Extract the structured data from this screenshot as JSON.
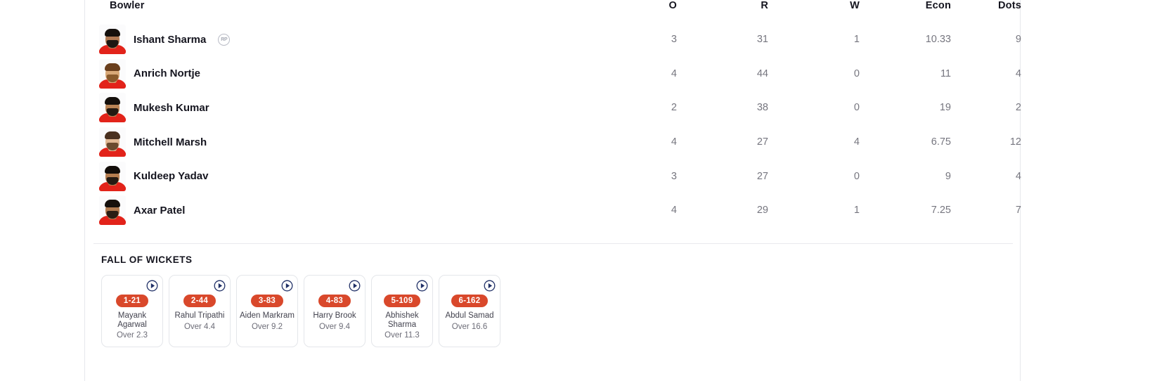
{
  "bowling": {
    "columns": [
      {
        "key": "bowler",
        "label": "Bowler"
      },
      {
        "key": "o",
        "label": "O"
      },
      {
        "key": "r",
        "label": "R"
      },
      {
        "key": "w",
        "label": "W"
      },
      {
        "key": "econ",
        "label": "Econ"
      },
      {
        "key": "dots",
        "label": "Dots"
      }
    ],
    "rows": [
      {
        "name": "Ishant Sharma",
        "badge": "RP",
        "o": "3",
        "r": "31",
        "w": "1",
        "econ": "10.33",
        "dots": "9",
        "avatar": {
          "skin": "#b07a54",
          "hair": "#15100d",
          "beard": "#1d1712",
          "jersey": "#e2231a"
        }
      },
      {
        "name": "Anrich Nortje",
        "badge": "",
        "o": "4",
        "r": "44",
        "w": "0",
        "econ": "11",
        "dots": "4",
        "avatar": {
          "skin": "#d8a878",
          "hair": "#6a3f1d",
          "beard": "#8a5a2c",
          "jersey": "#e2231a"
        }
      },
      {
        "name": "Mukesh Kumar",
        "badge": "",
        "o": "2",
        "r": "38",
        "w": "0",
        "econ": "19",
        "dots": "2",
        "avatar": {
          "skin": "#b98354",
          "hair": "#140f0b",
          "beard": "#241a12",
          "jersey": "#e2231a"
        }
      },
      {
        "name": "Mitchell Marsh",
        "badge": "",
        "o": "4",
        "r": "27",
        "w": "4",
        "econ": "6.75",
        "dots": "12",
        "avatar": {
          "skin": "#e0b894",
          "hair": "#4a3120",
          "beard": "#6b4a2e",
          "jersey": "#e2231a"
        }
      },
      {
        "name": "Kuldeep Yadav",
        "badge": "",
        "o": "3",
        "r": "27",
        "w": "0",
        "econ": "9",
        "dots": "4",
        "avatar": {
          "skin": "#b57d4f",
          "hair": "#120d09",
          "beard": "#241a12",
          "jersey": "#e2231a"
        }
      },
      {
        "name": "Axar Patel",
        "badge": "",
        "o": "4",
        "r": "29",
        "w": "1",
        "econ": "7.25",
        "dots": "7",
        "avatar": {
          "skin": "#b07a50",
          "hair": "#16100c",
          "beard": "#2a1d14",
          "jersey": "#e2231a"
        }
      }
    ]
  },
  "fall_of_wickets": {
    "title": "FALL OF WICKETS",
    "cards": [
      {
        "score": "1-21",
        "name": "Mayank Agarwal",
        "over": "Over 2.3",
        "play_icon": "play-circle-icon"
      },
      {
        "score": "2-44",
        "name": "Rahul Tripathi",
        "over": "Over 4.4",
        "play_icon": "play-circle-icon"
      },
      {
        "score": "3-83",
        "name": "Aiden Markram",
        "over": "Over 9.2",
        "play_icon": "play-circle-icon"
      },
      {
        "score": "4-83",
        "name": "Harry Brook",
        "over": "Over 9.4",
        "play_icon": "play-circle-icon"
      },
      {
        "score": "5-109",
        "name": "Abhishek Sharma",
        "over": "Over 11.3",
        "play_icon": "play-circle-icon"
      },
      {
        "score": "6-162",
        "name": "Abdul Samad",
        "over": "Over 16.6",
        "play_icon": "play-circle-icon"
      }
    ]
  },
  "colors": {
    "accent_red": "#d9482b",
    "jersey_red": "#e2231a",
    "play_navy": "#1f2f66",
    "text_dark": "#15151f",
    "text_muted": "#76767f",
    "border": "#e6e8ec"
  }
}
